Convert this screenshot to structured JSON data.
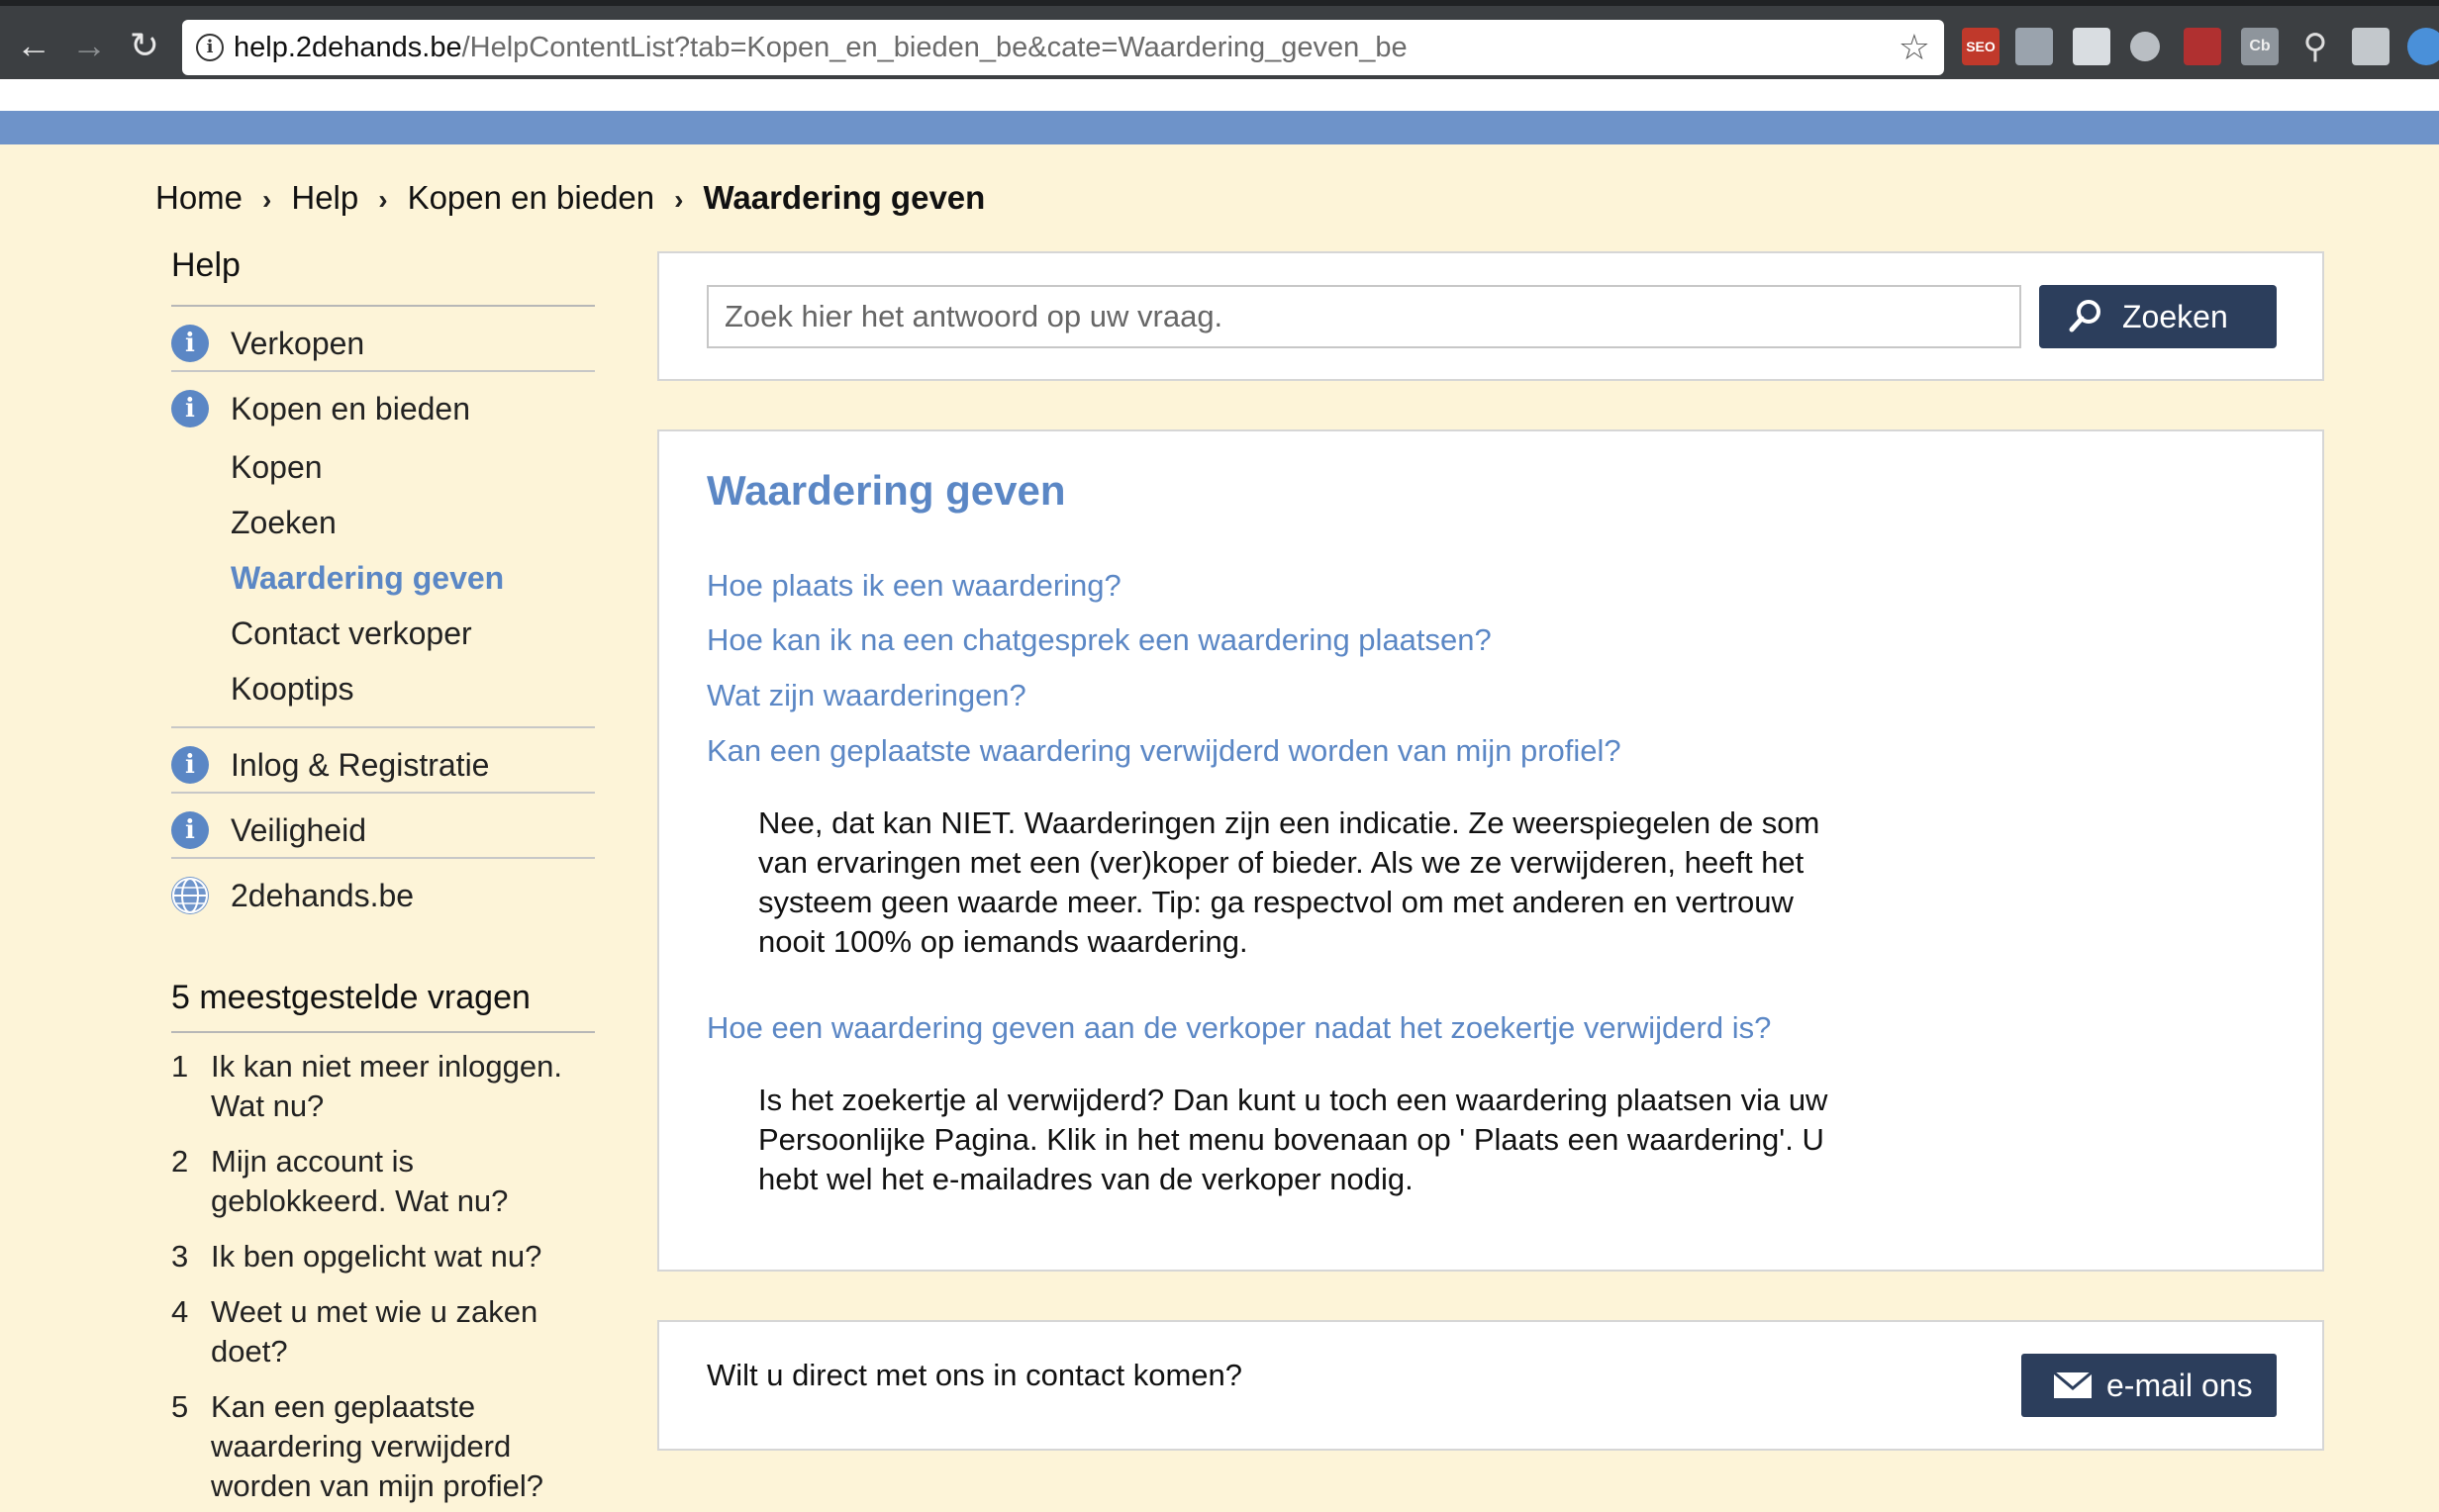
{
  "browser": {
    "url_host": "help.2dehands.be",
    "url_path": "/HelpContentList?tab=Kopen_en_bieden_be&cate=Waardering_geven_be",
    "extension_labels": [
      "SEO",
      "Cb"
    ]
  },
  "breadcrumb": [
    "Home",
    "Help",
    "Kopen en bieden",
    "Waardering geven"
  ],
  "sidebar": {
    "heading": "Help",
    "categories": [
      {
        "label": "Verkopen",
        "icon": "info-icon"
      },
      {
        "label": "Kopen en bieden",
        "icon": "info-icon"
      },
      {
        "label": "Inlog & Registratie",
        "icon": "info-icon"
      },
      {
        "label": "Veiligheid",
        "icon": "info-icon"
      },
      {
        "label": "2dehands.be",
        "icon": "globe-icon"
      }
    ],
    "subcategories": [
      "Kopen",
      "Zoeken",
      "Waardering geven",
      "Contact verkoper",
      "Kooptips"
    ],
    "active_subcategory": "Waardering geven",
    "faq_heading": "5 meestgestelde vragen",
    "faq": [
      {
        "num": "1",
        "text": "Ik kan niet meer inloggen. Wat nu?"
      },
      {
        "num": "2",
        "text": "Mijn account is geblokkeerd. Wat nu?"
      },
      {
        "num": "3",
        "text": "Ik ben opgelicht wat nu?"
      },
      {
        "num": "4",
        "text": "Weet u met wie u zaken doet?"
      },
      {
        "num": "5",
        "text": "Kan een geplaatste waardering verwijderd worden van mijn profiel?"
      }
    ]
  },
  "search": {
    "placeholder": "Zoek hier het antwoord op uw vraag.",
    "button_label": "Zoeken"
  },
  "content": {
    "title": "Waardering geven",
    "questions": [
      "Hoe plaats ik een waardering?",
      "Hoe kan ik na een chatgesprek een waardering plaatsen?",
      "Wat zijn waarderingen?",
      "Kan een geplaatste waardering verwijderd worden van mijn profiel?",
      "Hoe een waardering geven aan de verkoper nadat het zoekertje verwijderd is?"
    ],
    "answer_removed_rating": "Nee, dat kan NIET. Waarderingen zijn een indicatie. Ze weerspiegelen de som van ervaringen met een (ver)koper of bieder. Als we ze verwijderen, heeft het systeem geen waarde meer. Tip: ga respectvol om met anderen en vertrouw nooit 100% op iemands waardering.",
    "answer_deleted_ad": "Is het zoekertje al verwijderd? Dan kunt u toch een waardering plaatsen via uw Persoonlijke Pagina. Klik in het menu bovenaan op ' Plaats een waardering'. U hebt wel het e-mailadres van de verkoper nodig."
  },
  "contact": {
    "text": "Wilt u direct met ons in contact komen?",
    "button_label": "e-mail ons"
  },
  "colors": {
    "accent_blue": "#5b87c5",
    "button_navy": "#2c3e5c",
    "page_background": "#fdf4d8",
    "header_bar": "#6e93c9"
  }
}
